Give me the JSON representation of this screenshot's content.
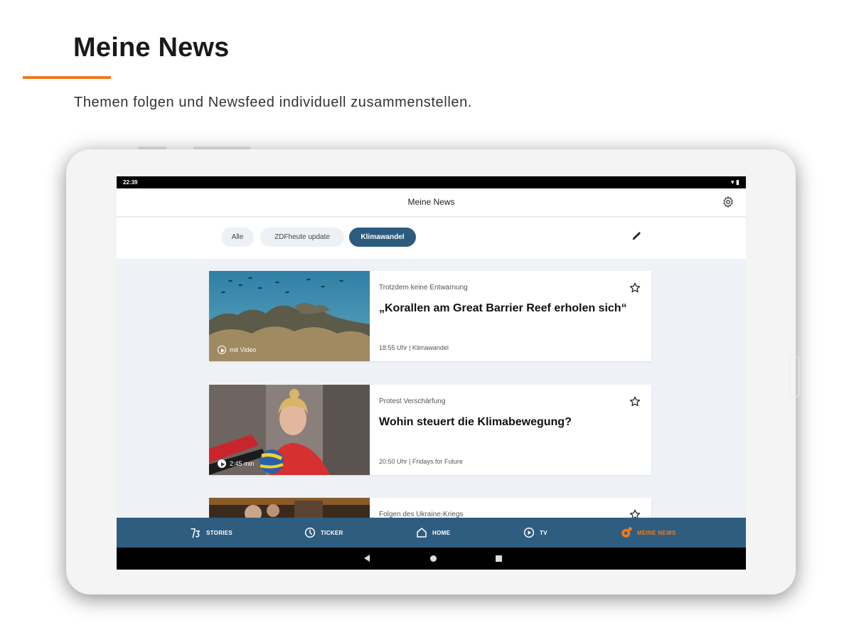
{
  "promo": {
    "title": "Meine News",
    "subtitle": "Themen folgen und Newsfeed individuell zusammenstellen.",
    "accent_color": "#f07a1a"
  },
  "status_bar": {
    "time": "22:39",
    "system_icons": "▾ ▮"
  },
  "app_bar": {
    "title": "Meine News",
    "settings_icon": "gear-icon"
  },
  "filter_chips": [
    {
      "label": "Alle",
      "active": false
    },
    {
      "label": "ZDFheute update",
      "active": false
    },
    {
      "label": "Klimawandel",
      "active": true
    }
  ],
  "edit_icon": "pencil-icon",
  "articles": [
    {
      "kicker": "Trotzdem keine Entwarnung",
      "headline": "„Korallen am Great Barrier Reef erholen sich“",
      "meta": "18:55 Uhr | Klimawandel",
      "media_label": "mit Video",
      "image": "coral-reef-photo"
    },
    {
      "kicker": "Protest Verschärfung",
      "headline": "Wohin steuert die Klimabewegung?",
      "meta": "20:50 Uhr | Fridays for Future",
      "media_label": "2:45 min",
      "image": "activist-photo"
    },
    {
      "kicker": "Folgen des Ukraine-Kriegs",
      "headline": "",
      "meta": "",
      "media_label": "",
      "image": "people-photo"
    }
  ],
  "bottom_nav": [
    {
      "label": "STORIES",
      "icon": "stories-icon",
      "active": false
    },
    {
      "label": "TICKER",
      "icon": "clock-icon",
      "active": false
    },
    {
      "label": "HOME",
      "icon": "house-icon",
      "active": false
    },
    {
      "label": "TV",
      "icon": "play-circle-icon",
      "active": false
    },
    {
      "label": "MEINE NEWS",
      "icon": "meine-news-icon",
      "active": true
    }
  ],
  "colors": {
    "nav_bg": "#2f5d80",
    "chip_active": "#2c5b7e",
    "accent": "#f07a1a"
  }
}
